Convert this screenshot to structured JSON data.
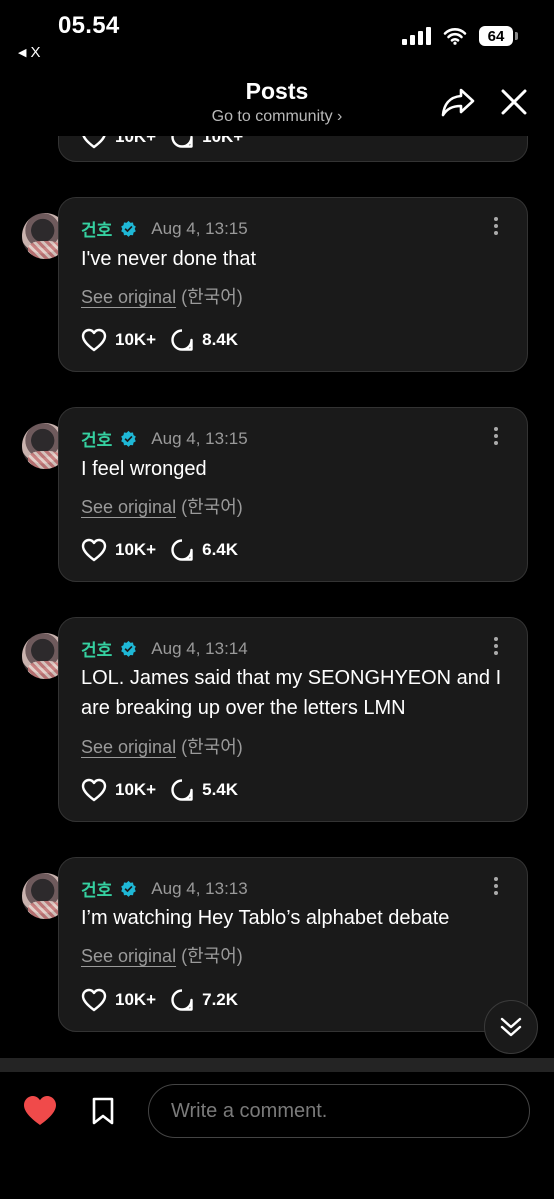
{
  "status": {
    "time": "05.54",
    "back_app": "X",
    "battery": "64"
  },
  "header": {
    "title": "Posts",
    "subtitle": "Go to community ›",
    "share_icon": "share-icon",
    "close_icon": "close-icon"
  },
  "partial_card": {
    "likes": "10K+",
    "comments": "10K+"
  },
  "posts": [
    {
      "author": "건호",
      "date": "Aug 4, 13:15",
      "text": "I've never done that",
      "see_original": "See original",
      "language": "(한국어)",
      "likes": "10K+",
      "comments": "8.4K"
    },
    {
      "author": "건호",
      "date": "Aug 4, 13:15",
      "text": "I feel wronged",
      "see_original": "See original",
      "language": "(한국어)",
      "likes": "10K+",
      "comments": "6.4K"
    },
    {
      "author": "건호",
      "date": "Aug 4, 13:14",
      "text": "LOL. James said that my SEONGHYEON and I are breaking up over the letters LMN",
      "see_original": "See original",
      "language": "(한국어)",
      "likes": "10K+",
      "comments": "5.4K"
    },
    {
      "author": "건호",
      "date": "Aug 4, 13:13",
      "text": "I’m watching Hey Tablo’s alphabet debate",
      "see_original": "See original",
      "language": "(한국어)",
      "likes": "10K+",
      "comments": "7.2K"
    }
  ],
  "bottom": {
    "comment_placeholder": "Write a comment."
  },
  "colors": {
    "author": "#35d0a0",
    "verified": "#1fb8d6",
    "liked_heart": "#f04a4a",
    "card_bg": "#1a1a1a"
  }
}
